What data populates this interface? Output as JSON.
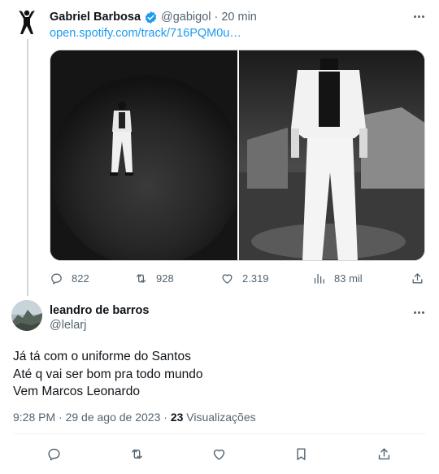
{
  "parent_tweet": {
    "author_name": "Gabriel Barbosa",
    "verified_icon": "verified-badge-icon",
    "handle": "@gabigol",
    "separator": "·",
    "time": "20 min",
    "link": "open.spotify.com/track/716PQM0u…",
    "actions": {
      "reply_count": "822",
      "retweet_count": "928",
      "like_count": "2.319",
      "views_count": "83 mil"
    }
  },
  "reply_tweet": {
    "author_name": "leandro de barros",
    "handle": "@lelarj",
    "lines": [
      "Já tá com o uniforme do Santos",
      "Até q vai ser bom pra todo mundo",
      "Vem Marcos Leonardo"
    ],
    "timestamp": "9:28 PM · 29 de ago de 2023 · ",
    "views_count": "23",
    "views_label": " Visualizações"
  },
  "colors": {
    "accent": "#1d9bf0",
    "text_primary": "#0f1419",
    "text_secondary": "#536471",
    "border": "#cfd9de"
  }
}
